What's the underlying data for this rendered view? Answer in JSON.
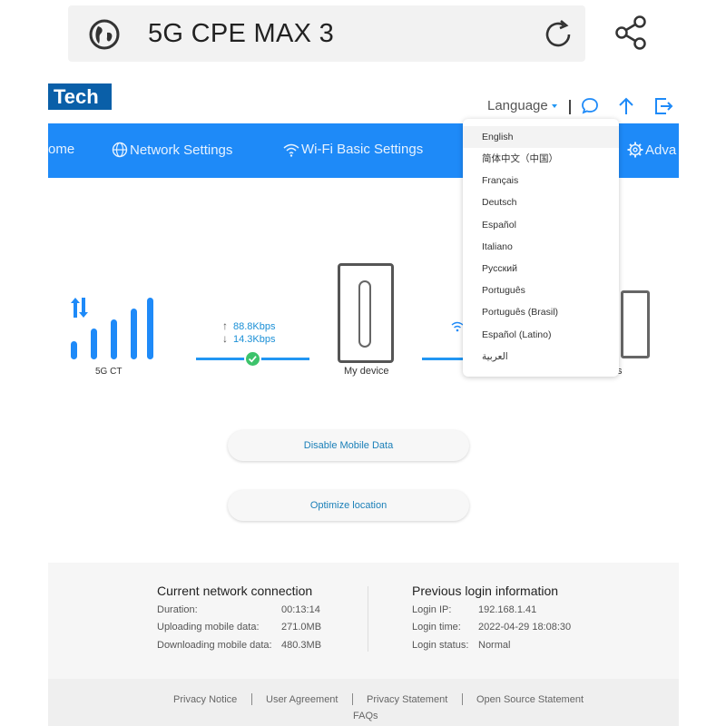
{
  "browser": {
    "title": "5G CPE MAX 3",
    "icons": [
      "globe-icon",
      "reload-icon",
      "share-icon"
    ]
  },
  "header": {
    "logo": "Tech",
    "language_label": "Language",
    "accent": "#1e8af8"
  },
  "nav": {
    "items": [
      "ome",
      "Network Settings",
      "Wi-Fi Basic Settings",
      "Adva"
    ]
  },
  "status": {
    "network_label": "5G CT",
    "upload_speed": "88.8Kbps",
    "download_speed": "14.3Kbps",
    "device_label": "My device",
    "clients_label_partial": "s"
  },
  "actions": {
    "disable_mobile_data": "Disable Mobile Data",
    "optimize_location": "Optimize location"
  },
  "current_connection": {
    "title": "Current network connection",
    "rows": [
      {
        "label": "Duration:",
        "value": "00:13:14"
      },
      {
        "label": "Uploading mobile data:",
        "value": "271.0MB"
      },
      {
        "label": "Downloading mobile data:",
        "value": "480.3MB"
      }
    ]
  },
  "previous_login": {
    "title": "Previous login information",
    "rows": [
      {
        "label": "Login IP:",
        "value": "192.168.1.41"
      },
      {
        "label": "Login time:",
        "value": "2022-04-29 18:08:30"
      },
      {
        "label": "Login status:",
        "value": "Normal"
      }
    ]
  },
  "footer": {
    "links": [
      "Privacy Notice",
      "User Agreement",
      "Privacy Statement",
      "Open Source Statement"
    ],
    "faqs": "FAQs"
  },
  "language_menu": {
    "selected": "English",
    "options": [
      "English",
      "简体中文（中国）",
      "Français",
      "Deutsch",
      "Español",
      "Italiano",
      "Русский",
      "Português",
      "Português (Brasil)",
      "Español (Latino)",
      "العربية"
    ]
  }
}
